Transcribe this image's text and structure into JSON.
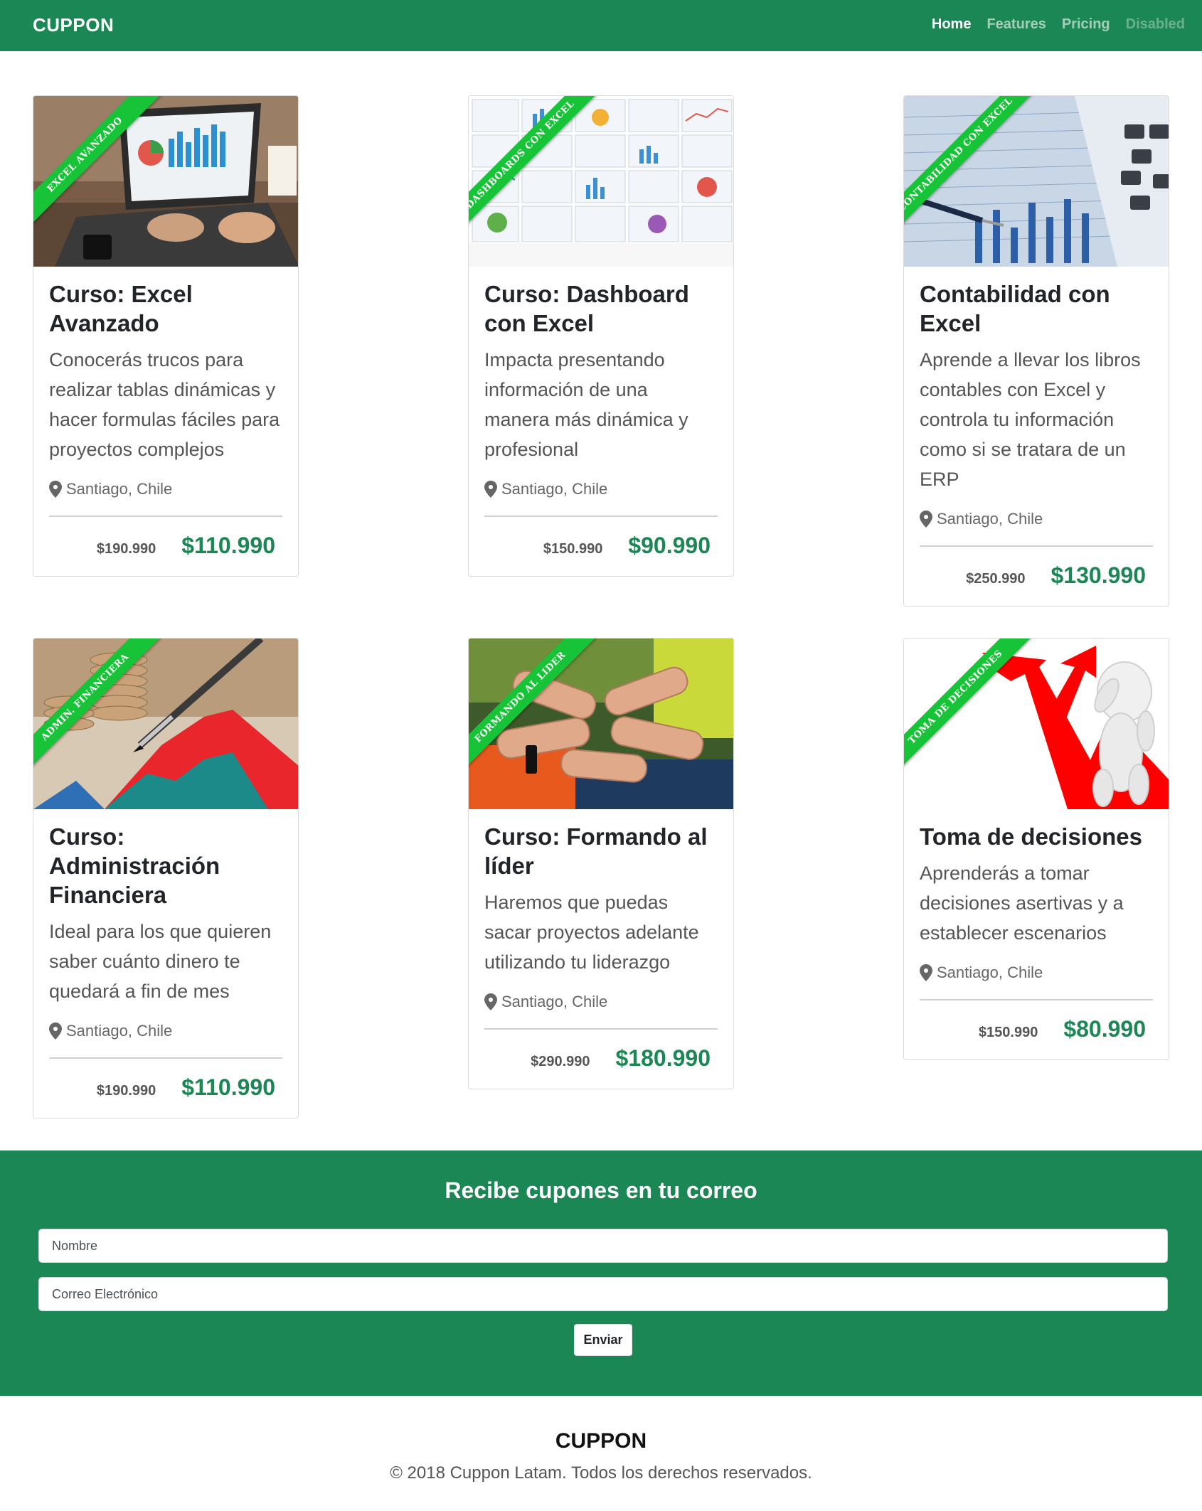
{
  "navbar": {
    "brand": "CUPPON",
    "links": [
      {
        "label": "Home"
      },
      {
        "label": "Features"
      },
      {
        "label": "Pricing"
      },
      {
        "label": "Disabled"
      }
    ]
  },
  "cards": [
    {
      "ribbon": "EXCEL AVANZADO",
      "title": "Curso: Excel Avanzado",
      "text": "Conocerás trucos para realizar tablas dinámicas y hacer formulas fáciles para proyectos complejos",
      "location": "Santiago, Chile",
      "old_price": "$190.990",
      "new_price": "$110.990"
    },
    {
      "ribbon": "DASHBOARDS CON EXCEL",
      "title": "Curso: Dashboard con Excel",
      "text": "Impacta presentando información de una manera más dinámica y profesional",
      "location": "Santiago, Chile",
      "old_price": "$150.990",
      "new_price": "$90.990"
    },
    {
      "ribbon": "CONTABILIDAD CON EXCEL",
      "title": "Contabilidad con Excel",
      "text": "Aprende a llevar los libros contables con Excel y controla tu información como si se tratara de un ERP",
      "location": "Santiago, Chile",
      "old_price": "$250.990",
      "new_price": "$130.990"
    },
    {
      "ribbon": "ADMIN. FINANCIERA",
      "title": "Curso: Administración Financiera",
      "text": "Ideal para los que quieren saber cuánto dinero te quedará a fin de mes",
      "location": "Santiago, Chile",
      "old_price": "$190.990",
      "new_price": "$110.990"
    },
    {
      "ribbon": "FORMANDO AL LIDER",
      "title": "Curso: Formando al líder",
      "text": "Haremos que puedas sacar proyectos adelante utilizando tu liderazgo",
      "location": "Santiago, Chile",
      "old_price": "$290.990",
      "new_price": "$180.990"
    },
    {
      "ribbon": "TOMA DE DECISIONES",
      "title": "Toma de decisiones",
      "text": "Aprenderás a tomar decisiones asertivas y a establecer escenarios",
      "location": "Santiago, Chile",
      "old_price": "$150.990",
      "new_price": "$80.990"
    }
  ],
  "newsletter": {
    "title": "Recibe cupones en tu correo",
    "name_placeholder": "Nombre",
    "email_placeholder": "Correo Electrónico",
    "submit_label": "Enviar"
  },
  "footer": {
    "brand": "CUPPON",
    "copyright": "© 2018 Cuppon Latam. Todos los derechos reservados."
  },
  "colors": {
    "primary": "#1a8754",
    "ribbon": "#18c437"
  }
}
